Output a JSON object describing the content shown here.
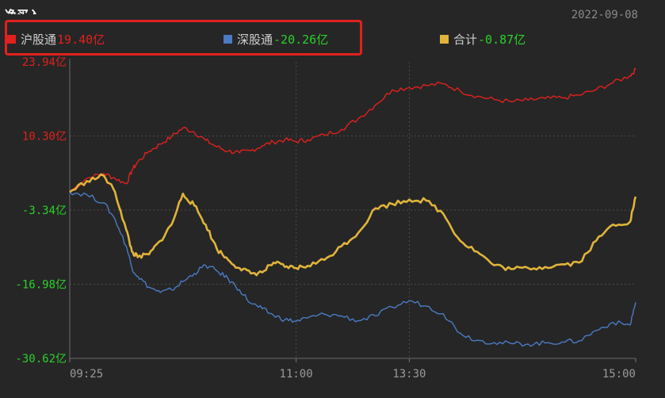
{
  "header": {
    "title": "净买入",
    "date": "2022-09-08"
  },
  "legend": [
    {
      "name": "沪股通",
      "value": "19.40亿",
      "color": "#e0211d",
      "value_color": "#e0211d"
    },
    {
      "name": "深股通",
      "value": "-20.26亿",
      "color": "#4a7bc4",
      "value_color": "#2bd12b"
    },
    {
      "name": "合计",
      "value": "-0.87亿",
      "color": "#e0b43a",
      "value_color": "#2bd12b"
    }
  ],
  "chart_data": {
    "type": "line",
    "title": "净买入",
    "xlabel": "",
    "ylabel": "",
    "ylim": [
      -30.62,
      23.94
    ],
    "x_ticks": [
      "09:25",
      "11:00",
      "13:30",
      "15:00"
    ],
    "x_tick_positions": [
      0,
      0.4,
      0.6,
      1.0
    ],
    "y_ticks": [
      {
        "value": 23.94,
        "label": "23.94亿",
        "color": "#e0211d"
      },
      {
        "value": 10.3,
        "label": "10.30亿",
        "color": "#e0211d"
      },
      {
        "value": -3.34,
        "label": "-3.34亿",
        "color": "#2bd12b"
      },
      {
        "value": -16.98,
        "label": "-16.98亿",
        "color": "#2bd12b"
      },
      {
        "value": -30.62,
        "label": "-30.62亿",
        "color": "#2bd12b"
      }
    ],
    "x": [
      0,
      0.03,
      0.06,
      0.08,
      0.1,
      0.11,
      0.12,
      0.14,
      0.16,
      0.18,
      0.2,
      0.22,
      0.24,
      0.26,
      0.28,
      0.3,
      0.32,
      0.34,
      0.36,
      0.38,
      0.4,
      0.42,
      0.45,
      0.48,
      0.51,
      0.54,
      0.57,
      0.6,
      0.63,
      0.66,
      0.69,
      0.72,
      0.75,
      0.78,
      0.81,
      0.84,
      0.87,
      0.9,
      0.93,
      0.96,
      0.99,
      1.0
    ],
    "series": [
      {
        "name": "沪股通",
        "color": "#e0211d",
        "values": [
          0.0,
          2.5,
          3.4,
          2.5,
          1.5,
          4.0,
          5.5,
          7.5,
          8.8,
          10.2,
          11.8,
          11.0,
          9.5,
          8.3,
          7.5,
          7.2,
          7.6,
          8.5,
          9.2,
          9.6,
          9.3,
          9.6,
          10.5,
          11.5,
          13.5,
          16.0,
          18.8,
          19.2,
          19.6,
          19.9,
          18.6,
          17.6,
          17.0,
          16.6,
          16.9,
          17.2,
          17.3,
          17.8,
          18.8,
          20.1,
          21.4,
          22.5
        ]
      },
      {
        "name": "深股通",
        "color": "#4a7bc4",
        "values": [
          0.0,
          -0.5,
          -2.0,
          -5.0,
          -10.0,
          -14.0,
          -15.5,
          -17.5,
          -18.5,
          -18.0,
          -16.5,
          -15.0,
          -13.5,
          -14.5,
          -16.0,
          -18.0,
          -20.5,
          -21.5,
          -22.7,
          -23.5,
          -23.8,
          -23.2,
          -22.5,
          -22.8,
          -23.7,
          -22.8,
          -21.2,
          -20.0,
          -21.0,
          -22.4,
          -26.0,
          -27.3,
          -27.7,
          -27.9,
          -28.0,
          -27.8,
          -27.6,
          -27.4,
          -25.5,
          -24.0,
          -24.5,
          -20.3
        ]
      },
      {
        "name": "合计",
        "color": "#e0b43a",
        "values": [
          0.0,
          2.0,
          3.0,
          0.0,
          -7.0,
          -11.0,
          -12.0,
          -11.5,
          -9.0,
          -6.0,
          -0.3,
          -2.5,
          -6.0,
          -10.5,
          -12.5,
          -14.0,
          -15.0,
          -14.8,
          -13.0,
          -13.8,
          -14.0,
          -13.6,
          -12.5,
          -10.0,
          -7.5,
          -3.0,
          -2.2,
          -1.4,
          -1.6,
          -4.0,
          -9.0,
          -11.0,
          -13.5,
          -14.2,
          -14.0,
          -13.8,
          -13.3,
          -13.0,
          -9.0,
          -6.0,
          -5.5,
          -0.87
        ]
      }
    ],
    "grid": true,
    "legend_position": "top"
  }
}
